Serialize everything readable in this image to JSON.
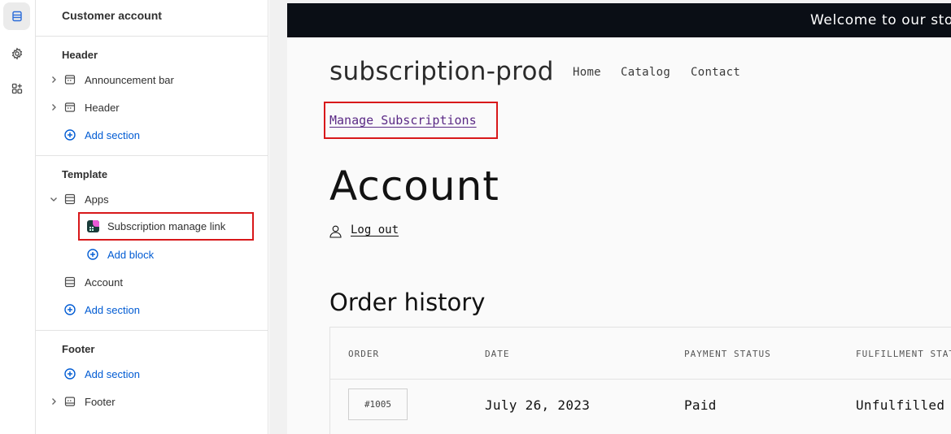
{
  "sidebar": {
    "title": "Customer account",
    "groups": {
      "header": {
        "title": "Header",
        "items": [
          "Announcement bar",
          "Header"
        ],
        "add_label": "Add section"
      },
      "template": {
        "title": "Template",
        "apps_label": "Apps",
        "block_label": "Subscription manage link",
        "add_block_label": "Add block",
        "account_label": "Account",
        "add_label": "Add section"
      },
      "footer": {
        "title": "Footer",
        "add_label": "Add section",
        "item_label": "Footer"
      }
    }
  },
  "preview": {
    "announcement": "Welcome to our store",
    "store_name": "subscription-prod",
    "nav": [
      "Home",
      "Catalog",
      "Contact"
    ],
    "manage_link": "Manage Subscriptions",
    "account_heading": "Account",
    "logout_label": "Log out",
    "order_heading": "Order history",
    "table": {
      "headers": [
        "ORDER",
        "DATE",
        "PAYMENT STATUS",
        "FULFILLMENT STATUS"
      ],
      "rows": [
        {
          "order": "#1005",
          "date": "July 26, 2023",
          "payment": "Paid",
          "fulfillment": "Unfulfilled"
        }
      ]
    }
  },
  "colors": {
    "accent": "#005bd3",
    "highlight": "#d8181a",
    "announcement_bg": "#0a0e15",
    "link": "#5b2a86"
  }
}
